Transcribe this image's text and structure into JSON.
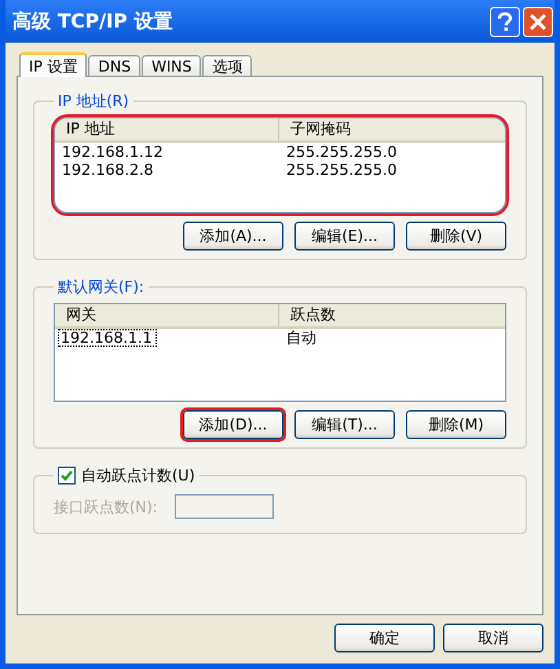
{
  "window": {
    "title": "高级 TCP/IP 设置"
  },
  "tabs": [
    {
      "label": "IP 设置",
      "selected": true
    },
    {
      "label": "DNS",
      "selected": false
    },
    {
      "label": "WINS",
      "selected": false
    },
    {
      "label": "选项",
      "selected": false
    }
  ],
  "ip_group": {
    "title": "IP 地址(R)",
    "columns": [
      "IP 地址",
      "子网掩码"
    ],
    "highlighted": true,
    "rows": [
      {
        "cells": [
          "192.168.1.12",
          "255.255.255.0"
        ],
        "focused": false
      },
      {
        "cells": [
          "192.168.2.8",
          "255.255.255.0"
        ],
        "focused": false
      }
    ],
    "buttons": [
      {
        "label": "添加(A)...",
        "highlighted": false
      },
      {
        "label": "编辑(E)...",
        "highlighted": false
      },
      {
        "label": "删除(V)",
        "highlighted": false
      }
    ]
  },
  "gateway_group": {
    "title": "默认网关(F):",
    "columns": [
      "网关",
      "跃点数"
    ],
    "highlighted": false,
    "rows": [
      {
        "cells": [
          "192.168.1.1",
          "自动"
        ],
        "focused": true
      }
    ],
    "buttons": [
      {
        "label": "添加(D)...",
        "highlighted": true
      },
      {
        "label": "编辑(T)...",
        "highlighted": false
      },
      {
        "label": "删除(M)",
        "highlighted": false
      }
    ]
  },
  "metric": {
    "label": "自动跃点计数(U)",
    "checked": true,
    "field_label": "接口跃点数(N):",
    "disabled": true
  },
  "dialog_buttons": [
    "确定",
    "取消"
  ]
}
